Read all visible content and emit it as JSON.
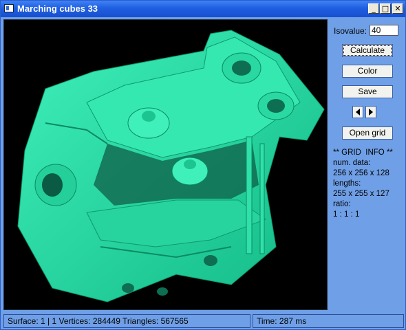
{
  "window": {
    "title": "Marching cubes 33"
  },
  "titlebar_buttons": {
    "minimize": "_",
    "maximize": "□",
    "close": "✕"
  },
  "controls": {
    "isovalue_label": "Isovalue:",
    "isovalue_value": "40",
    "calculate": "Calculate",
    "color": "Color",
    "save": "Save",
    "open_grid": "Open grid",
    "prev_icon": "arrow-left-icon",
    "next_icon": "arrow-right-icon"
  },
  "grid_info": {
    "header": "** GRID  INFO **",
    "num_data_label": "num. data:",
    "num_data": "256 x 256 x 128",
    "lengths_label": "lengths:",
    "lengths": "255 x 255 x 127",
    "ratio_label": "ratio:",
    "ratio": "1 : 1 : 1"
  },
  "status": {
    "surface_info": "Surface: 1 | 1   Vertices: 284449   Triangles: 567565",
    "time": "Time: 287 ms"
  },
  "colors": {
    "surface": "#1fe6a8",
    "viewport_background": "#000000",
    "panel_background": "#6f9fe6",
    "titlebar": "#1f5fe0"
  }
}
